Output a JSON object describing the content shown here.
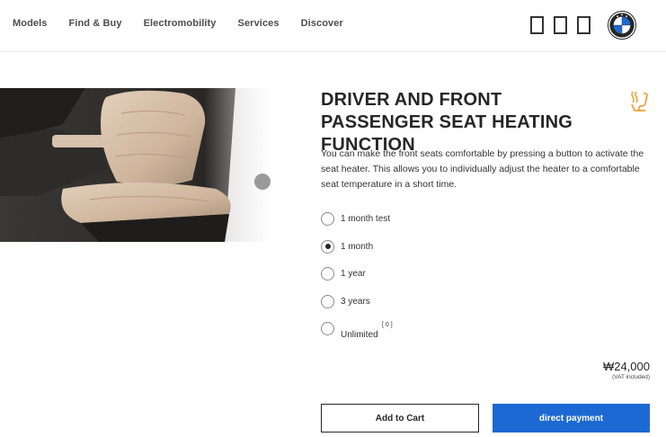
{
  "nav": {
    "items": [
      {
        "label": "Models"
      },
      {
        "label": "Find & Buy"
      },
      {
        "label": "Electromobility"
      },
      {
        "label": "Services"
      },
      {
        "label": "Discover"
      }
    ]
  },
  "colors": {
    "accent_blue": "#1c69d4",
    "text": "#262626",
    "icon_orange": "#f0a33a"
  },
  "product": {
    "title": "DRIVER AND FRONT PASSENGER SEAT HEATING FUNCTION",
    "description": "You can make the front seats comfortable by pressing a button to activate the seat heater. This allows you to individually adjust the heater to a comfortable seat temperature in a short time.",
    "icon": "seat-heating-icon",
    "options": [
      {
        "label": "1 month test",
        "selected": false
      },
      {
        "label": "1 month",
        "selected": true
      },
      {
        "label": "1 year",
        "selected": false
      },
      {
        "label": "3 years",
        "selected": false
      },
      {
        "label": "Unlimited",
        "note": "[ 0 ]",
        "selected": false
      }
    ],
    "price": "₩24,000",
    "vat_note": "(VAT included)"
  },
  "buttons": {
    "add_to_cart": "Add to Cart",
    "direct_payment": "direct payment"
  }
}
